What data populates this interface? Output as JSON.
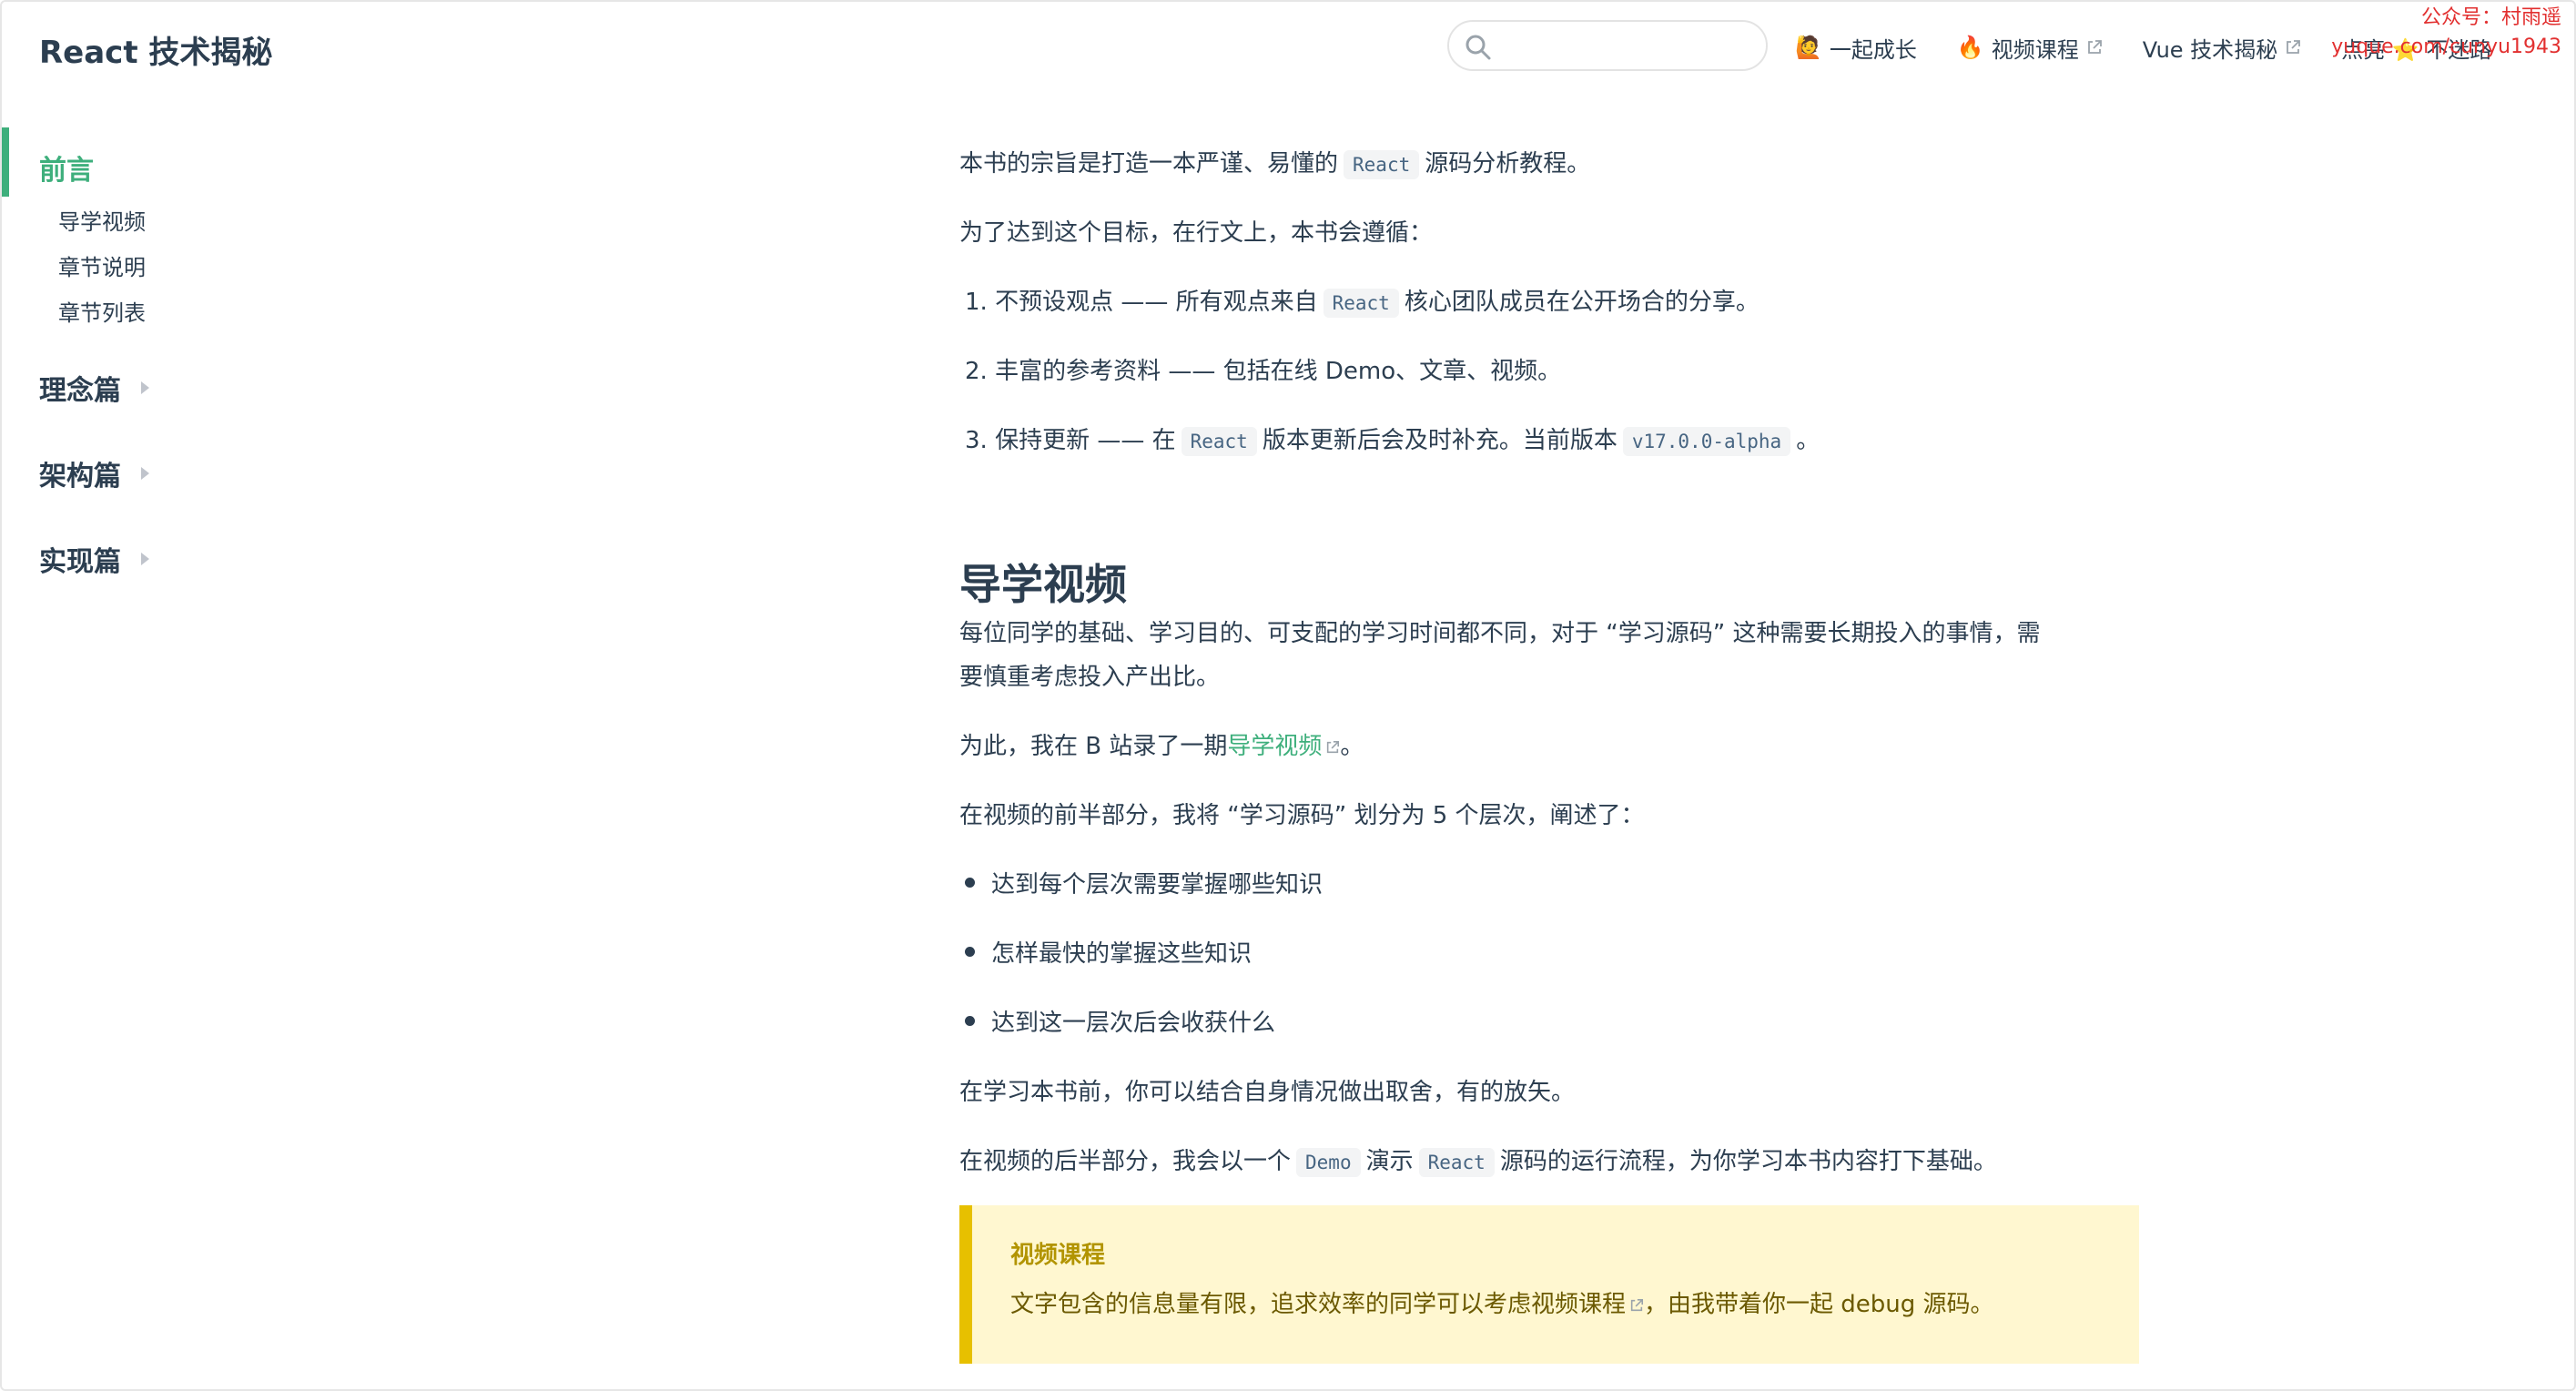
{
  "site": {
    "title": "React 技术揭秘"
  },
  "search": {
    "placeholder": ""
  },
  "nav": {
    "items": [
      {
        "emoji": "🙋",
        "label": "一起成长"
      },
      {
        "emoji": "🔥",
        "label": "视频课程"
      },
      {
        "emoji": "",
        "label": "Vue 技术揭秘"
      },
      {
        "emoji": "",
        "label": "点亮 ⭐ 不迷路"
      }
    ]
  },
  "watermark": {
    "line1": "公众号：村雨遥",
    "line2": "yuque.com/cunyu1943"
  },
  "sidebar": {
    "current": "前言",
    "sub": [
      "导学视频",
      "章节说明",
      "章节列表"
    ],
    "groups": [
      "理念篇",
      "架构篇",
      "实现篇"
    ]
  },
  "content": {
    "p1": {
      "pre": "本书的宗旨是打造一本严谨、易懂的",
      "code": "React",
      "post": "源码分析教程。"
    },
    "p2": "为了达到这个目标，在行文上，本书会遵循：",
    "ol": [
      {
        "pre": "1. 不预设观点 —— 所有观点来自",
        "code": "React",
        "post": "核心团队成员在公开场合的分享。"
      },
      {
        "pre": "2. 丰富的参考资料 —— 包括在线 Demo、文章、视频。"
      },
      {
        "pre": "3. 保持更新 —— 在",
        "code": "React",
        "mid": "版本更新后会及时补充。当前版本",
        "code2": "v17.0.0-alpha",
        "post": "。"
      }
    ],
    "h2": "导学视频",
    "p3a": "每位同学的基础、学习目的、可支配的学习时间都不同，对于 “学习源码” 这种需要长期投入的事情，需",
    "p3b": "要慎重考虑投入产出比。",
    "p4": {
      "pre": "为此，我在 B 站录了一期",
      "link": "导学视频",
      "post": "。"
    },
    "p5": "在视频的前半部分，我将 “学习源码” 划分为 5 个层次，阐述了：",
    "bullets": [
      "达到每个层次需要掌握哪些知识",
      "怎样最快的掌握这些知识",
      "达到这一层次后会收获什么"
    ],
    "p6": "在学习本书前，你可以结合自身情况做出取舍，有的放矢。",
    "p7": {
      "pre": "在视频的后半部分，我会以一个",
      "code": "Demo",
      "mid": "演示",
      "code2": "React",
      "post": "源码的运行流程，为你学习本书内容打下基础。"
    },
    "tip": {
      "title": "视频课程",
      "pre": "文字包含的信息量有限，追求效率的同学可以考虑",
      "link": "视频课程",
      "post": "，由我带着你一起 debug 源码。"
    }
  },
  "colors": {
    "accent": "#3eaf7c",
    "text": "#2c3e50",
    "tip_bg": "#fff7d0",
    "tip_border": "#e7c000",
    "watermark": "#e23030"
  }
}
